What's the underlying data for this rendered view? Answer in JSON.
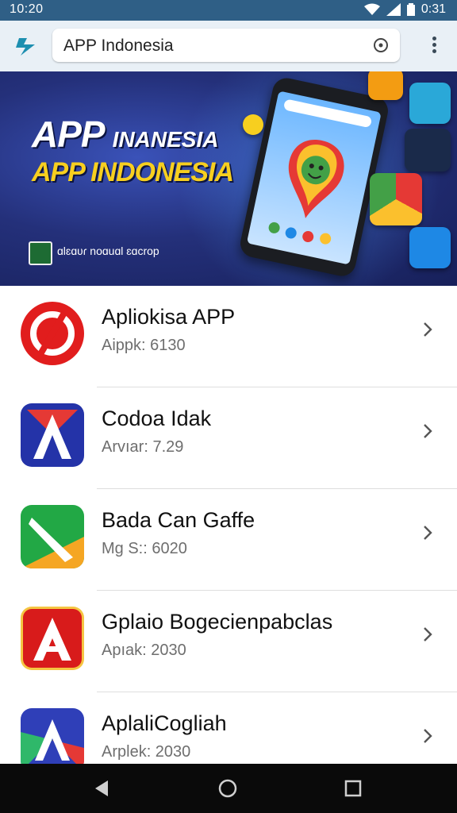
{
  "status": {
    "time": "10:20",
    "battery_time": "0:31"
  },
  "search": {
    "value": "APP Indonesia"
  },
  "banner": {
    "title_line1": "APP",
    "title_line1_small": "INANESIA",
    "title_line2": "APP INDONESIA",
    "caption": "ɑlɛɑʋɾ noɑuɑl ɛɑcrop"
  },
  "apps": [
    {
      "title": "Apliokisa APP",
      "subtitle": "Aippk: 6130",
      "icon": "red-circle-logo-icon"
    },
    {
      "title": "Codoa Idak",
      "subtitle": "Arvıar: 7.29",
      "icon": "blue-red-a-logo-icon"
    },
    {
      "title": "Bada Can Gaffe",
      "subtitle": "Mg S:: 6020",
      "icon": "green-orange-logo-icon"
    },
    {
      "title": "Gplaio Bogecienpabclas",
      "subtitle": "Apıak: 2030",
      "icon": "red-a-logo-icon"
    },
    {
      "title": "AplaliCogliah",
      "subtitle": "Arplek: 2030",
      "icon": "blue-green-a-logo-icon"
    }
  ],
  "colors": {
    "statusbar": "#2f5f86",
    "appbar": "#e9f0f6",
    "accent_yellow": "#f7cf1f"
  },
  "icons": [
    "back-icon",
    "home-icon",
    "recents-icon",
    "more-vert-icon",
    "clear-icon",
    "chevron-right-icon",
    "wifi-icon",
    "signal-icon",
    "battery-icon"
  ]
}
